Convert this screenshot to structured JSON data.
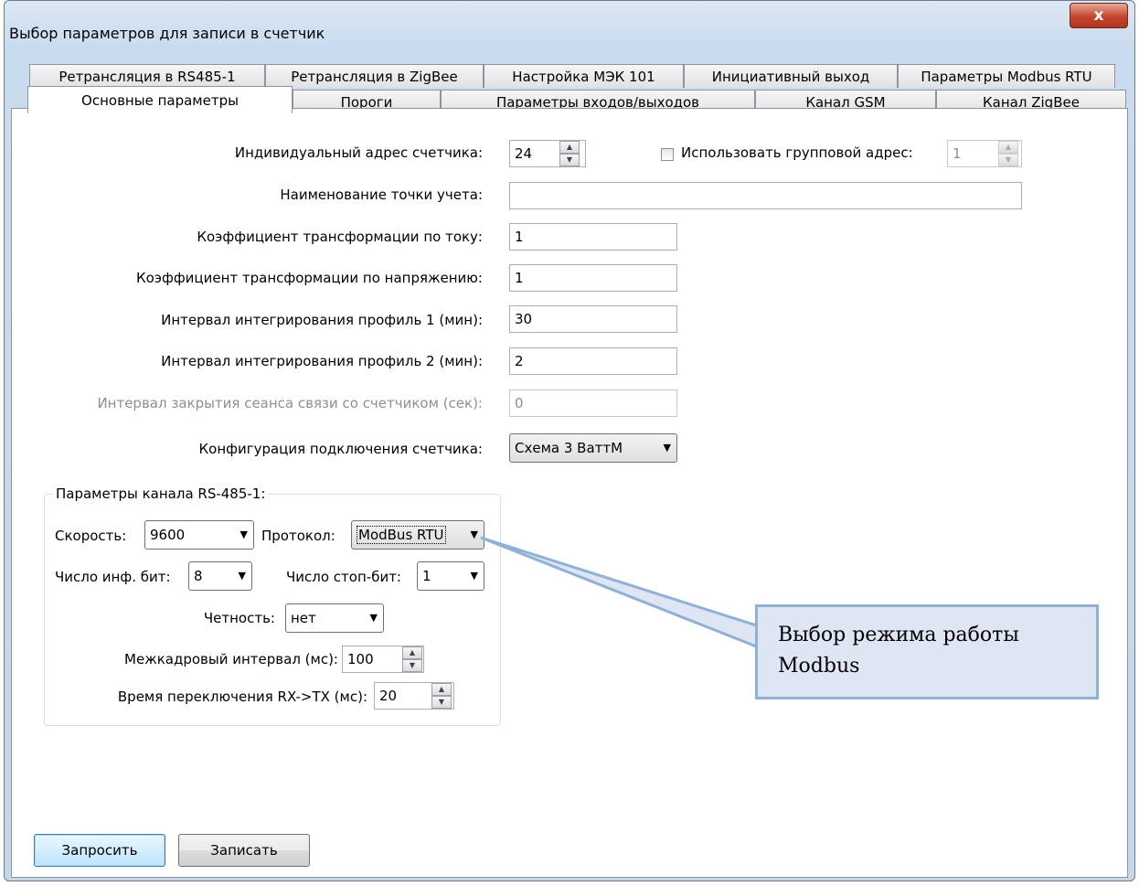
{
  "window": {
    "title": "Выбор параметров для записи в счетчик",
    "close_label": "x"
  },
  "tabs_row1": [
    "Ретрансляция в RS485-1",
    "Ретрансляция в ZigBee",
    "Настройка МЭК 101",
    "Инициативный выход",
    "Параметры Modbus RTU"
  ],
  "tabs_row2": [
    "Основные параметры",
    "Пороги",
    "Параметры входов/выходов",
    "Канал GSM",
    "Канал ZigBee"
  ],
  "selected_tab": "Основные параметры",
  "main": {
    "address_label": "Индивидуальный адрес счетчика:",
    "address_value": "24",
    "group_address_label": "Использовать групповой адрес:",
    "group_address_checked": false,
    "group_address_value": "1",
    "point_name_label": "Наименование точки учета:",
    "point_name_value": "",
    "current_ratio_label": "Коэффициент трансформации по току:",
    "current_ratio_value": "1",
    "voltage_ratio_label": "Коэффициент трансформации по напряжению:",
    "voltage_ratio_value": "1",
    "profile1_label": "Интервал интегрирования профиль 1 (мин):",
    "profile1_value": "30",
    "profile2_label": "Интервал интегрирования профиль 2 (мин):",
    "profile2_value": "2",
    "session_close_label": "Интервал закрытия сеанса связи со счетчиком (сек):",
    "session_close_value": "0",
    "connection_config_label": "Конфигурация подключения счетчика:",
    "connection_config_value": "Схема 3 ВаттМ"
  },
  "rs485": {
    "group_title": "Параметры канала RS-485-1:",
    "speed_label": "Скорость:",
    "speed_value": "9600",
    "protocol_label": "Протокол:",
    "protocol_value": "ModBus RTU",
    "data_bits_label": "Число инф. бит:",
    "data_bits_value": "8",
    "stop_bits_label": "Число стоп-бит:",
    "stop_bits_value": "1",
    "parity_label": "Четность:",
    "parity_value": "нет",
    "interframe_label": "Межкадровый интервал (мс):",
    "interframe_value": "100",
    "switch_time_label": "Время переключения RX->TX (мс):",
    "switch_time_value": "20"
  },
  "buttons": {
    "request": "Запросить",
    "write": "Записать"
  },
  "callout": {
    "line1": "Выбор режима работы",
    "line2": "Modbus"
  },
  "colors": {
    "callout_fill": "#dde6f2",
    "callout_border": "#8fb1d9",
    "close_button": "#c5442c"
  }
}
